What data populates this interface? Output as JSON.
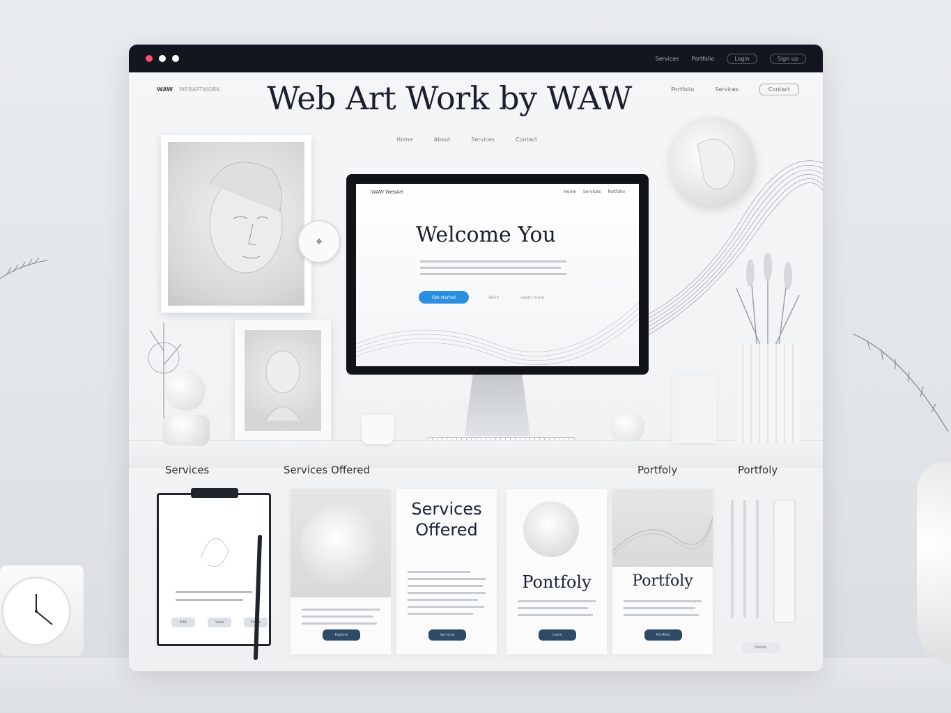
{
  "titlebar": {
    "dots": [
      "#ff4d6a",
      "#ffffff",
      "#ffffff"
    ],
    "links": [
      "Services",
      "Portfolio"
    ],
    "buttons": [
      "Login",
      "Sign up"
    ]
  },
  "site": {
    "logo": "WAW",
    "logo_sub": "WEBARTWORK",
    "title": "Web Art Work by WAW",
    "nav": [
      "Portfolio",
      "Services"
    ],
    "nav_button": "Contact",
    "subnav": [
      "Home",
      "About",
      "Services",
      "Contact"
    ]
  },
  "screen": {
    "logo": "WAW WebArt",
    "nav": [
      "Home",
      "Services",
      "Portfolio"
    ],
    "heading": "Welcome You",
    "cta": "Get started",
    "links": [
      "Work",
      "Learn more"
    ]
  },
  "sections": {
    "labels": [
      "Services",
      "Services Offered",
      "Portfoly",
      "Portfoly"
    ]
  },
  "clipboard": {
    "buttons": [
      "Edit",
      "View",
      "Share"
    ]
  },
  "cards": [
    {
      "title": "",
      "button": "Explore"
    },
    {
      "title": "Services Offered",
      "button": "Services"
    },
    {
      "title": "Pontfoly",
      "button": "Learn"
    },
    {
      "title": "Portfoly",
      "button": "Portfolio"
    }
  ],
  "tools_button": "Details",
  "colors": {
    "titlebar": "#121620",
    "accent": "#2a8fe0",
    "card_button": "#2f4a66"
  }
}
